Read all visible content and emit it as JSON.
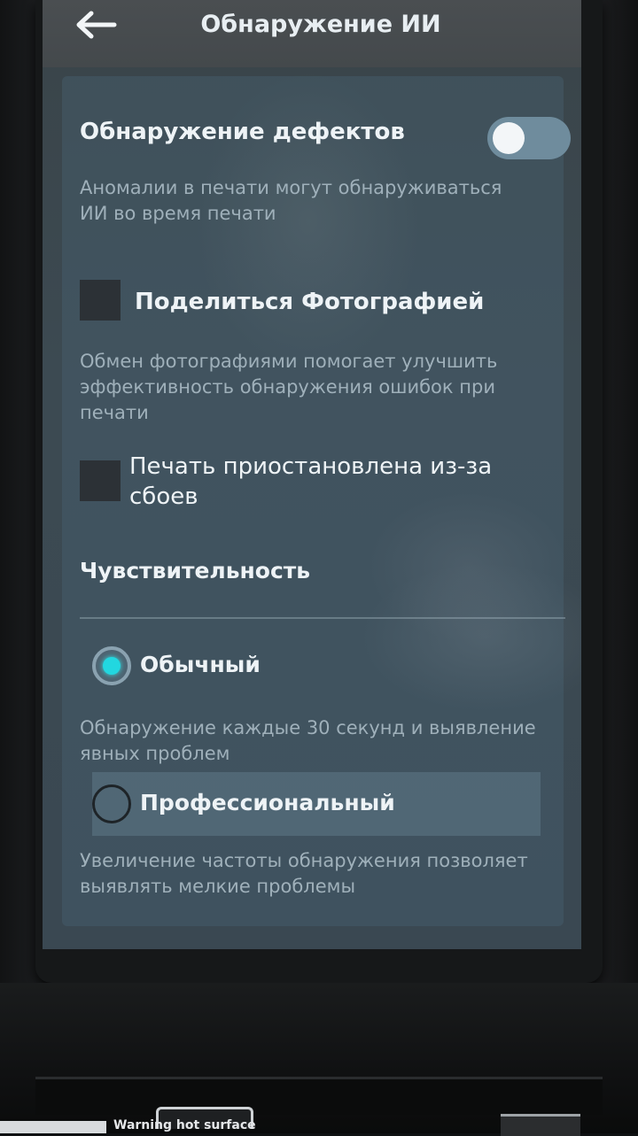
{
  "header": {
    "title": "Обнаружение ИИ",
    "back_icon": "arrow-left-icon"
  },
  "defect_detection": {
    "label": "Обнаружение дефектов",
    "description_line1": "Аномалии в печати могут обнаруживаться",
    "description_line2": "ИИ во время печати",
    "toggle_on": false
  },
  "share_photo": {
    "label": "Поделиться Фотографией",
    "description_line1": "Обмен фотографиями помогает улучшить",
    "description_line2": "эффективность обнаружения ошибок при",
    "description_line3": "печати",
    "checked": false
  },
  "pause_on_failure": {
    "label_line1": "Печать приостановлена из-за",
    "label_line2": "сбоев",
    "checked": false
  },
  "sensitivity": {
    "heading": "Чувствительность",
    "selected": "normal",
    "options": [
      {
        "id": "normal",
        "label": "Обычный",
        "description_line1": "Обнаружение каждые 30 секунд и выявление",
        "description_line2": "явных проблем"
      },
      {
        "id": "professional",
        "label": "Профессиональный",
        "description_line1": "Увеличение частоты обнаружения позволяет",
        "description_line2": "выявлять мелкие проблемы"
      }
    ]
  },
  "device": {
    "warning_sticker": "Warning hot surface"
  },
  "colors": {
    "accent": "#22d7e0",
    "toggle_track": "#6f8c9d",
    "text_primary": "#eef3f6",
    "text_secondary": "#9fb0ba"
  }
}
